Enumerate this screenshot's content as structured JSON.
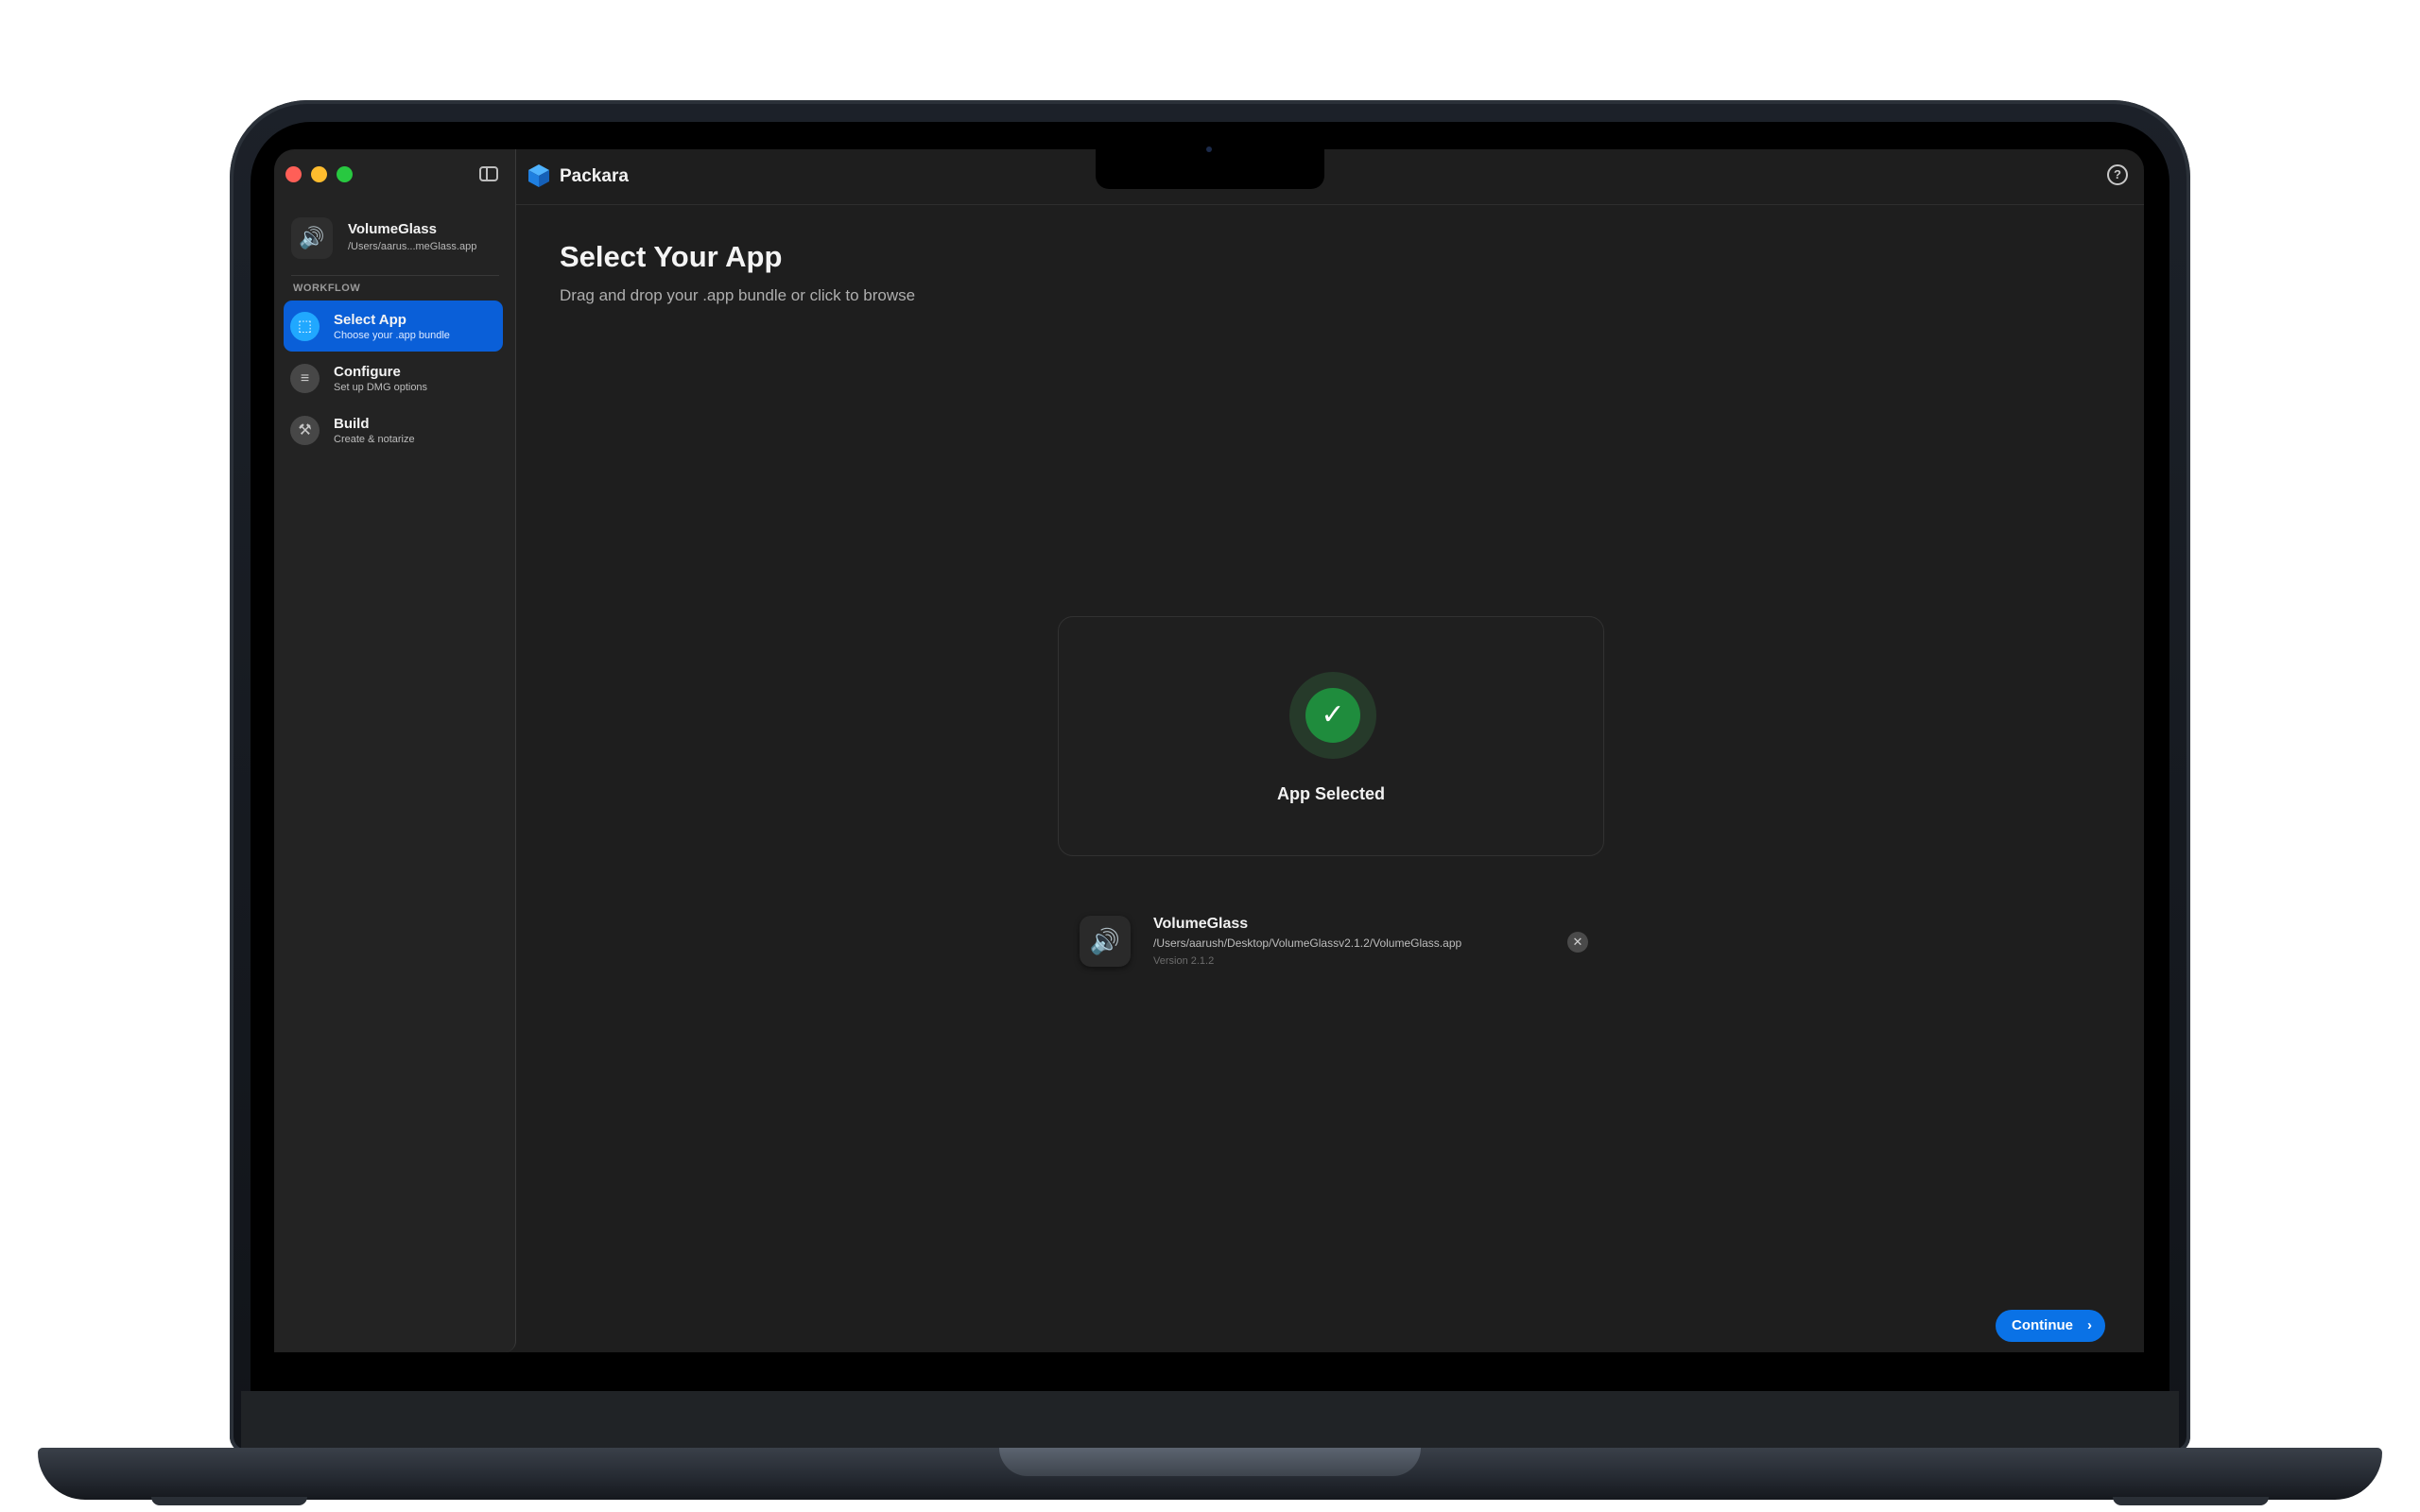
{
  "window": {
    "app_title": "Packara",
    "help_icon_glyph": "?"
  },
  "sidebar": {
    "current_app": {
      "name": "VolumeGlass",
      "path": "/Users/aarus...meGlass.app",
      "icon": "speaker-icon",
      "icon_glyph": "🔊"
    },
    "section_label": "WORKFLOW",
    "items": [
      {
        "label": "Select App",
        "subtitle": "Choose your .app bundle",
        "icon": "select-app-icon",
        "icon_glyph": "⬚",
        "active": true
      },
      {
        "label": "Configure",
        "subtitle": "Set up DMG options",
        "icon": "list-icon",
        "icon_glyph": "≡",
        "active": false
      },
      {
        "label": "Build",
        "subtitle": "Create & notarize",
        "icon": "hammer-icon",
        "icon_glyph": "⚒",
        "active": false
      }
    ]
  },
  "main": {
    "title": "Select Your App",
    "subtitle": "Drag and drop your .app bundle or click to browse",
    "drop_zone": {
      "status_label": "App Selected",
      "check_glyph": "✓"
    },
    "selected_app": {
      "name": "VolumeGlass",
      "path": "/Users/aarush/Desktop/VolumeGlassv2.1.2/VolumeGlass.app",
      "version": "Version 2.1.2",
      "icon_glyph": "🔊",
      "remove_glyph": "✕"
    },
    "continue_label": "Continue",
    "continue_chevron": "›"
  },
  "colors": {
    "accent": "#0a72e6",
    "sidebar_selection": "#0a5fd8",
    "success": "#1f8c3d",
    "background": "#1e1e1e"
  }
}
